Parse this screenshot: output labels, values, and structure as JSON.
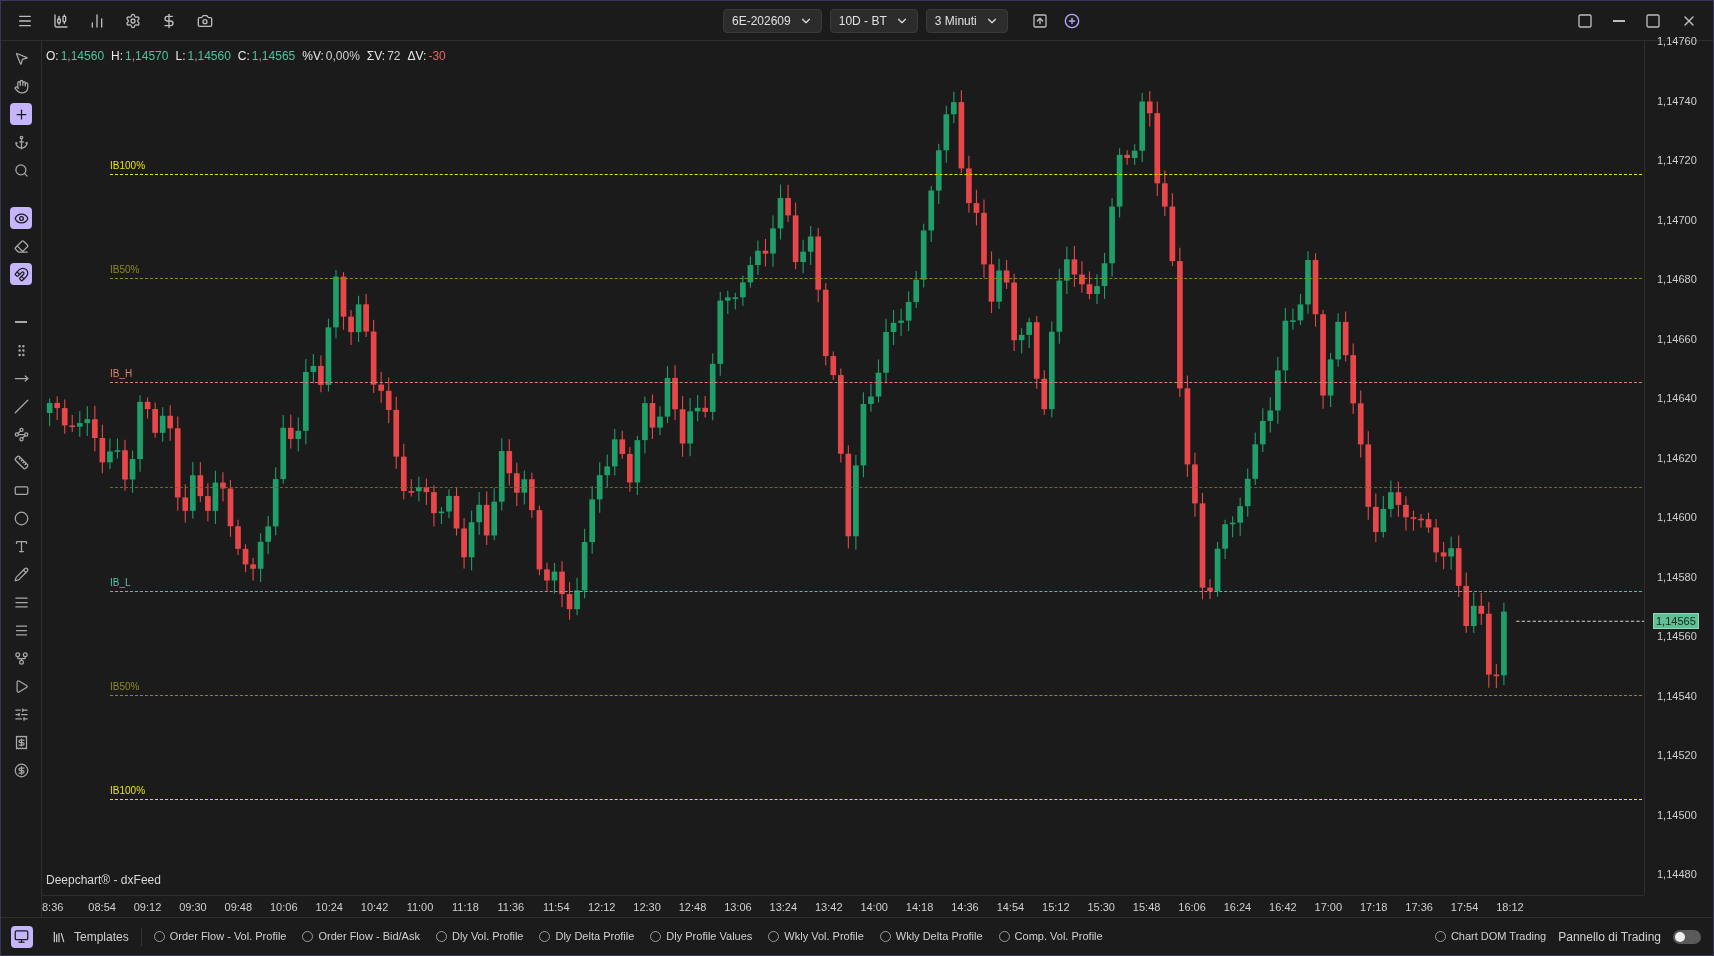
{
  "header": {
    "instrument": "6E-202609",
    "range": "10D - BT",
    "timeframe": "3 Minuti"
  },
  "tools": [
    {
      "kind": "pointer",
      "active": false
    },
    {
      "kind": "hand",
      "active": false
    },
    {
      "kind": "cross",
      "active": true
    },
    {
      "kind": "anchor",
      "active": false
    },
    {
      "kind": "zoom",
      "active": false
    },
    {
      "kind": "eye",
      "active": true
    },
    {
      "kind": "eraser",
      "active": false
    },
    {
      "kind": "magnet",
      "active": true
    },
    {
      "kind": "hline",
      "active": false
    },
    {
      "kind": "vline",
      "active": false
    },
    {
      "kind": "ray",
      "active": false
    },
    {
      "kind": "line",
      "active": false
    },
    {
      "kind": "polyline",
      "active": false
    },
    {
      "kind": "ruler",
      "active": false
    },
    {
      "kind": "rect",
      "active": false
    },
    {
      "kind": "ellipse",
      "active": false
    },
    {
      "kind": "text",
      "active": false
    },
    {
      "kind": "pencil",
      "active": false
    },
    {
      "kind": "lines",
      "active": false
    },
    {
      "kind": "lines2",
      "active": false
    },
    {
      "kind": "fork",
      "active": false
    },
    {
      "kind": "play",
      "active": false
    },
    {
      "kind": "sliders",
      "active": false
    },
    {
      "kind": "receipt",
      "active": false
    },
    {
      "kind": "coin",
      "active": false
    }
  ],
  "ohlc": [
    {
      "label": "O:",
      "value": "1,14560",
      "color": "#4fc1a0"
    },
    {
      "label": "H:",
      "value": "1,14570",
      "color": "#4fc1a0"
    },
    {
      "label": "L:",
      "value": "1,14560",
      "color": "#4fc1a0"
    },
    {
      "label": "C:",
      "value": "1,14565",
      "color": "#4fc1a0"
    },
    {
      "label": "%V:",
      "value": "0,00%",
      "color": "#d0d0d0"
    },
    {
      "label": "ΣV:",
      "value": "72",
      "color": "#d0d0d0"
    },
    {
      "label": "ΔV:",
      "value": "-30",
      "color": "#f0605a"
    }
  ],
  "chart": {
    "levels": [
      {
        "label": "IB100%",
        "color": "#e6e600"
      },
      {
        "label": "IB50%",
        "color": "#8c8a1e"
      },
      {
        "label": "IB_H",
        "color": "#d9826e"
      },
      {
        "color": "#6b6a2a"
      },
      {
        "label": "IB_L",
        "color": "#4fc1b0"
      },
      {
        "label": "IB50%",
        "color": "#8c8a1e"
      },
      {
        "label": "IB100%",
        "color": "#e6e600"
      }
    ],
    "price_ticks": [
      "1,14760",
      "1,14740",
      "1,14720",
      "1,14700",
      "1,14680",
      "1,14660",
      "1,14640",
      "1,14620",
      "1,14600",
      "1,14580",
      "1,14560",
      "1,14540",
      "1,14520",
      "1,14500",
      "1,14480"
    ],
    "last_price": "1,14565",
    "source": "Deepchart® - dxFeed",
    "time_ticks": [
      "8:36",
      "08:54",
      "09:12",
      "09:30",
      "09:48",
      "10:06",
      "10:24",
      "10:42",
      "11:00",
      "11:18",
      "11:36",
      "11:54",
      "12:12",
      "12:30",
      "12:48",
      "13:06",
      "13:24",
      "13:42",
      "14:00",
      "14:18",
      "14:36",
      "14:54",
      "15:12",
      "15:30",
      "15:48",
      "16:06",
      "16:24",
      "16:42",
      "17:00",
      "17:18",
      "17:36",
      "17:54",
      "18:12"
    ]
  },
  "footer": {
    "templates": "Templates",
    "monitor_active": true,
    "options": [
      {
        "label": "Order Flow - Vol. Profile",
        "selected": false
      },
      {
        "label": "Order Flow - Bid/Ask",
        "selected": false
      },
      {
        "label": "Dly Vol. Profile",
        "selected": false
      },
      {
        "label": "Dly Delta Profile",
        "selected": false
      },
      {
        "label": "Dly Profile Values",
        "selected": false
      },
      {
        "label": "Wkly Vol. Profile",
        "selected": false
      },
      {
        "label": "Wkly Delta Profile",
        "selected": false
      },
      {
        "label": "Comp. Vol. Profile",
        "selected": false
      }
    ],
    "dom": {
      "label": "Chart DOM Trading",
      "selected": false
    },
    "panel": {
      "label": "Pannello di Trading",
      "on": false
    }
  }
}
